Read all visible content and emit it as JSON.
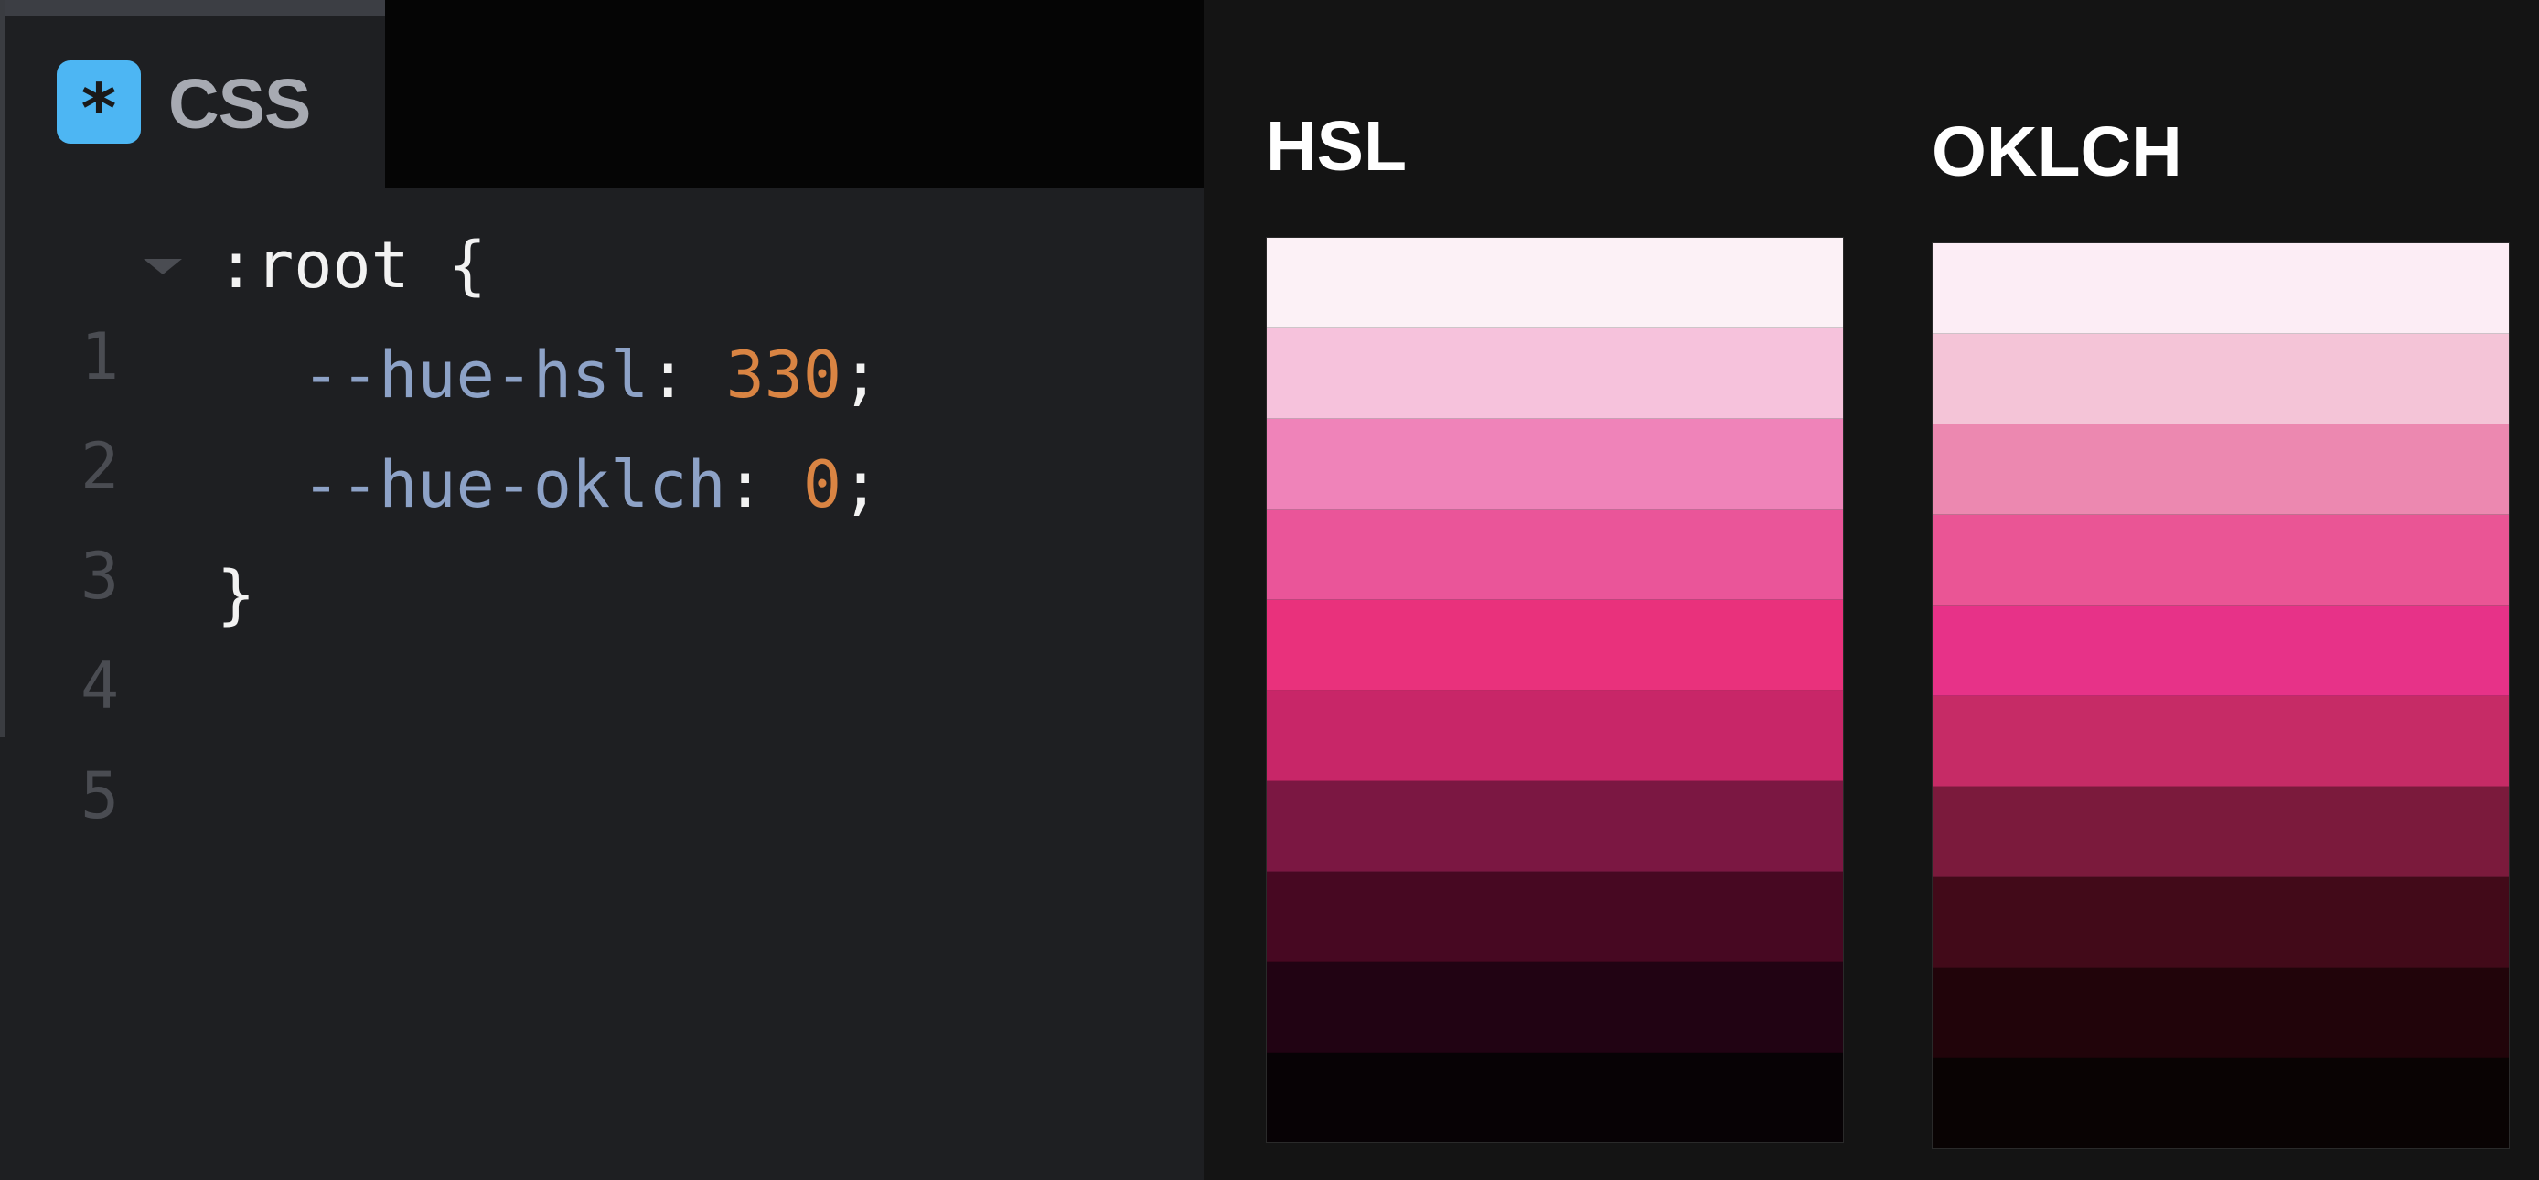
{
  "editor": {
    "tab": {
      "icon": "asterisk-icon",
      "icon_glyph": "*",
      "label": "CSS"
    },
    "lines": [
      {
        "number": "1",
        "has_fold": true
      },
      {
        "number": "2",
        "has_fold": false
      },
      {
        "number": "3",
        "has_fold": false
      },
      {
        "number": "4",
        "has_fold": false
      },
      {
        "number": "5",
        "has_fold": false
      }
    ],
    "code": {
      "line1": {
        "selector": ":root",
        "brace_open": " {"
      },
      "line2": {
        "property": "--hue-hsl",
        "colon": ": ",
        "value": "330",
        "semicolon": ";"
      },
      "line3": {
        "property": "--hue-oklch",
        "colon": ": ",
        "value": "0",
        "semicolon": ";"
      },
      "line4": {
        "brace_close": "}"
      }
    }
  },
  "preview": {
    "columns": [
      {
        "title": "HSL",
        "swatches": [
          "#fcf1f6",
          "#f6c2dc",
          "#ef83b9",
          "#ea5599",
          "#e9317c",
          "#c82668",
          "#7b1742",
          "#470822",
          "#210313",
          "#070205"
        ]
      },
      {
        "title": "OKLCH",
        "swatches": [
          "#fcedf5",
          "#f4c4d7",
          "#ec88b0",
          "#ea5595",
          "#e73288",
          "#c62b66",
          "#7b1a3c",
          "#420a19",
          "#21040a",
          "#090303"
        ]
      }
    ]
  },
  "colors": {
    "editor_bg": "#1e1f22",
    "tabbar_bg": "#050505",
    "preview_bg": "#141414",
    "accent_icon": "#4db6f3",
    "property": "#8da2c7",
    "number": "#d98443"
  }
}
